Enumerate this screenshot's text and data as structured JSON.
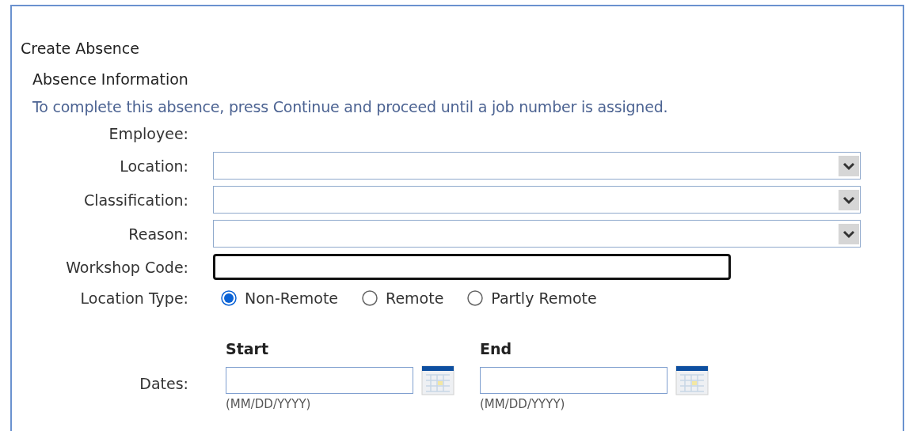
{
  "title": "Create Absence",
  "section": "Absence Information",
  "note": "To complete this absence, press Continue and proceed until a job number is assigned.",
  "fields": [
    {
      "kind": "static",
      "label": "Employee:"
    },
    {
      "kind": "select",
      "label": "Location:"
    },
    {
      "kind": "select",
      "label": "Classification:"
    },
    {
      "kind": "select",
      "label": "Reason:"
    },
    {
      "kind": "text",
      "label": "Workshop Code:",
      "focused": true
    },
    {
      "kind": "radio",
      "label": "Location Type:",
      "options": [
        {
          "label": "Non-Remote",
          "selected": true
        },
        {
          "label": "Remote",
          "selected": false
        },
        {
          "label": "Partly Remote",
          "selected": false
        }
      ]
    },
    {
      "kind": "dates",
      "label": "Dates:",
      "dates": [
        {
          "heading": "Start",
          "hint": "(MM/DD/YYYY)"
        },
        {
          "heading": "End",
          "hint": "(MM/DD/YYYY)"
        }
      ]
    }
  ]
}
